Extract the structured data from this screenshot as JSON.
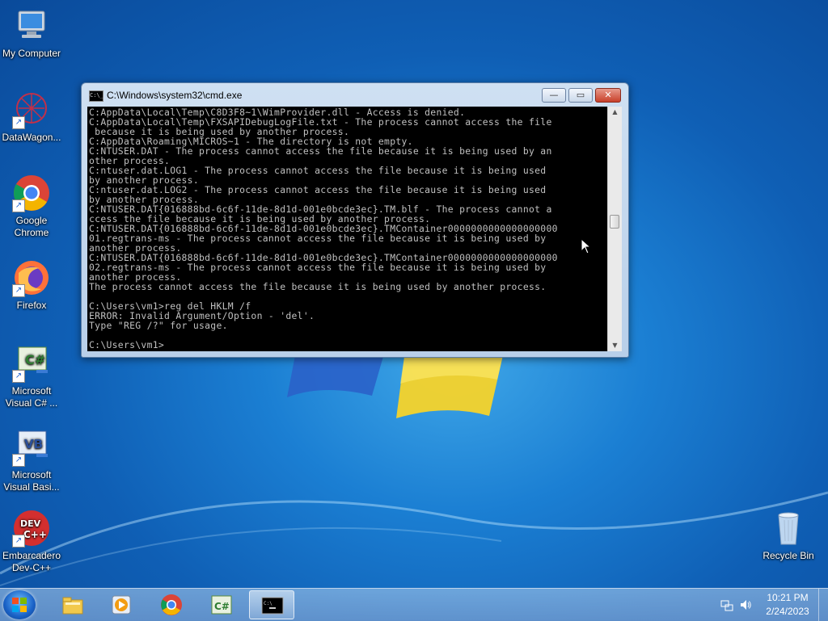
{
  "desktop": {
    "icons": [
      {
        "label": "My Computer",
        "icon": "computer-icon"
      },
      {
        "label": "DataWagon...",
        "icon": "datawagon-icon"
      },
      {
        "label": "Google Chrome",
        "icon": "chrome-icon"
      },
      {
        "label": "Firefox",
        "icon": "firefox-icon"
      },
      {
        "label": "Microsoft Visual C# ...",
        "icon": "visual-csharp-icon"
      },
      {
        "label": "Microsoft Visual Basi...",
        "icon": "visual-basic-icon"
      },
      {
        "label": "Embarcadero Dev-C++",
        "icon": "devcpp-icon"
      },
      {
        "label": "Recycle Bin",
        "icon": "recycle-bin-icon"
      }
    ]
  },
  "window": {
    "title": "C:\\Windows\\system32\\cmd.exe",
    "buttons": {
      "minimize": "—",
      "maximize": "▭",
      "close": "✕"
    },
    "console_lines": [
      "C:AppData\\Local\\Temp\\C8D3F8~1\\WimProvider.dll - Access is denied.",
      "C:AppData\\Local\\Temp\\FXSAPIDebugLogFile.txt - The process cannot access the file",
      " because it is being used by another process.",
      "C:AppData\\Roaming\\MICROS~1 - The directory is not empty.",
      "C:NTUSER.DAT - The process cannot access the file because it is being used by an",
      "other process.",
      "C:ntuser.dat.LOG1 - The process cannot access the file because it is being used",
      "by another process.",
      "C:ntuser.dat.LOG2 - The process cannot access the file because it is being used",
      "by another process.",
      "C:NTUSER.DAT{016888bd-6c6f-11de-8d1d-001e0bcde3ec}.TM.blf - The process cannot a",
      "ccess the file because it is being used by another process.",
      "C:NTUSER.DAT{016888bd-6c6f-11de-8d1d-001e0bcde3ec}.TMContainer0000000000000000000",
      "01.regtrans-ms - The process cannot access the file because it is being used by",
      "another process.",
      "C:NTUSER.DAT{016888bd-6c6f-11de-8d1d-001e0bcde3ec}.TMContainer0000000000000000000",
      "02.regtrans-ms - The process cannot access the file because it is being used by",
      "another process.",
      "The process cannot access the file because it is being used by another process.",
      "",
      "C:\\Users\\vm1>reg del HKLM /f",
      "ERROR: Invalid Argument/Option - 'del'.",
      "Type \"REG /?\" for usage.",
      "",
      "C:\\Users\\vm1>"
    ]
  },
  "taskbar": {
    "start": "start-orb-icon",
    "items": [
      {
        "icon": "explorer-icon",
        "active": false
      },
      {
        "icon": "media-player-icon",
        "active": false
      },
      {
        "icon": "chrome-icon",
        "active": false
      },
      {
        "icon": "visual-csharp-icon",
        "active": false
      },
      {
        "icon": "cmd-icon",
        "active": true
      }
    ],
    "tray": {
      "time": "10:21 PM",
      "date": "2/24/2023"
    }
  }
}
